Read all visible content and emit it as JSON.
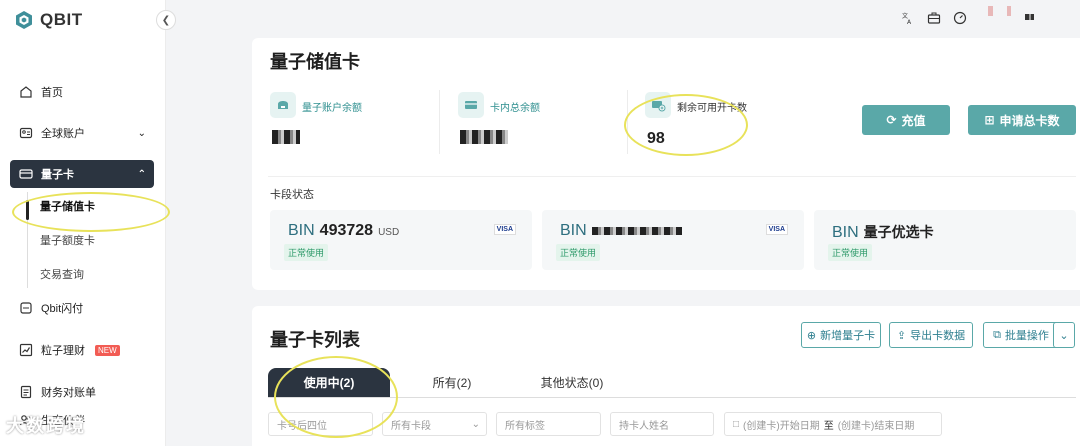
{
  "app": {
    "name": "QBIT"
  },
  "sidebar": {
    "items": [
      {
        "label": "首页",
        "icon": "home-icon"
      },
      {
        "label": "全球账户",
        "icon": "account-card-icon"
      },
      {
        "label": "量子卡",
        "icon": "card-icon"
      },
      {
        "label": "Qbit闪付",
        "icon": "pay-icon"
      },
      {
        "label": "粒子理财",
        "icon": "chart-icon",
        "badge": "NEW"
      },
      {
        "label": "财务对账单",
        "icon": "statement-icon"
      },
      {
        "label": "生态伙伴",
        "icon": "partners-icon"
      }
    ],
    "subitems": [
      "量子储值卡",
      "量子额度卡",
      "交易查询"
    ]
  },
  "page": {
    "title": "量子储值卡"
  },
  "stats": [
    {
      "label": "量子账户余额"
    },
    {
      "label": "卡内总余额"
    },
    {
      "label": "剩余可用开卡数",
      "value": "98"
    }
  ],
  "actions": {
    "recharge": "充值",
    "apply": "申请总卡数"
  },
  "bin_section": {
    "label": "卡段状态",
    "cards": [
      {
        "prefix": "BIN",
        "number": "493728",
        "currency": "USD",
        "brand": "VISA",
        "status": "正常使用"
      },
      {
        "prefix": "BIN",
        "brand": "VISA",
        "status": "正常使用"
      },
      {
        "prefix": "BIN",
        "name": "量子优选卡",
        "status": "正常使用"
      }
    ]
  },
  "list": {
    "title": "量子卡列表",
    "buttons": {
      "add": "新增量子卡",
      "export": "导出卡数据",
      "batch": "批量操作"
    },
    "tabs": [
      "使用中(2)",
      "所有(2)",
      "其他状态(0)"
    ],
    "filters": {
      "last4": "卡号后四位",
      "bin": "所有卡段",
      "tags": "所有标签",
      "holder": "持卡人姓名",
      "date_start": "(创建卡)开始日期",
      "date_sep": "至",
      "date_end": "(创建卡)结束日期"
    }
  },
  "watermark": "大数跨境",
  "colors": {
    "accent": "#5aa8a8",
    "dark": "#2b3440",
    "highlight": "#e8e25a"
  }
}
